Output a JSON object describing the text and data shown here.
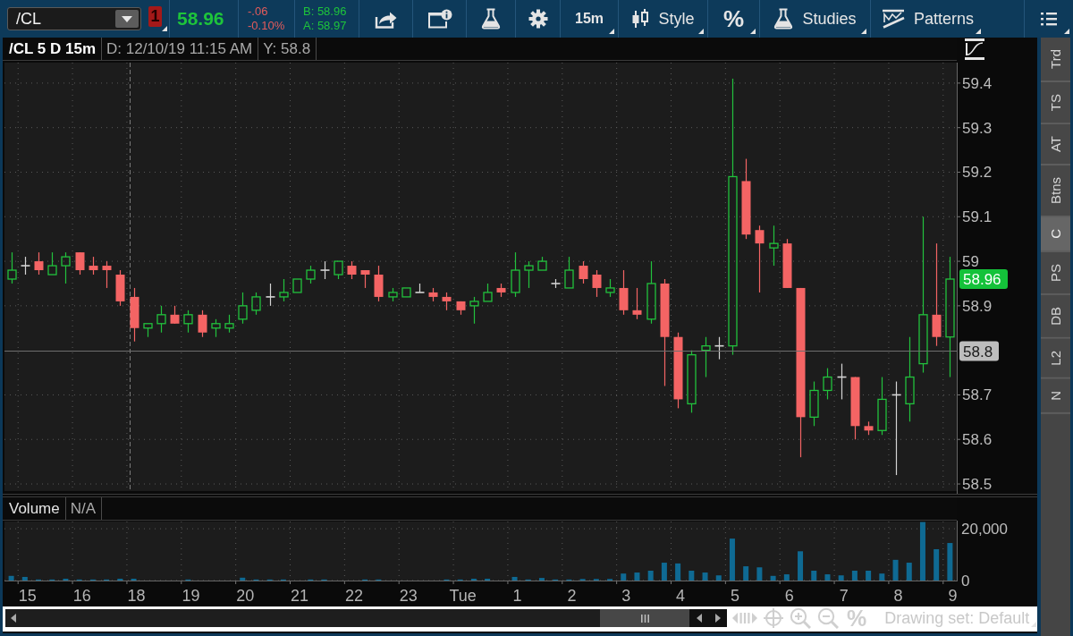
{
  "toolbar": {
    "symbol": "/CL",
    "alert_count": "1",
    "last_price": "58.96",
    "net_change": "-.06",
    "percent_change": "-0.10%",
    "bid": "B: 58.96",
    "ask": "A: 58.97",
    "buttons": [
      {
        "kind": "share",
        "dropdown": false
      },
      {
        "kind": "info",
        "dropdown": false
      },
      {
        "kind": "flask",
        "dropdown": false
      },
      {
        "kind": "gear",
        "dropdown": false
      },
      {
        "kind": "interval",
        "label": "15m",
        "dropdown": true
      },
      {
        "kind": "style",
        "label": "Style",
        "dropdown": true
      },
      {
        "kind": "percent",
        "label": "%",
        "dropdown": true
      },
      {
        "kind": "studies",
        "label": "Studies",
        "dropdown": true
      },
      {
        "kind": "patterns",
        "label": "Patterns",
        "dropdown": true
      },
      {
        "kind": "menu",
        "dropdown": true
      }
    ]
  },
  "chart": {
    "header": {
      "title": "/CL 5 D 15m",
      "date": "D: 12/10/19 11:15 AM",
      "cursor_value": "Y: 58.8"
    },
    "chart_data": {
      "type": "candlestick",
      "categories": [
        null,
        null,
        null,
        null,
        null,
        null,
        null,
        null,
        null,
        null,
        null,
        null,
        null,
        null,
        null,
        null,
        null,
        null,
        null,
        null,
        null,
        null,
        null,
        null,
        null,
        null,
        null,
        null,
        null,
        null,
        null,
        null,
        null,
        null,
        null,
        null,
        null,
        null,
        null,
        null,
        null,
        null,
        null,
        null,
        null,
        null,
        null,
        null,
        null,
        null,
        null,
        null,
        null,
        null,
        null,
        null,
        null,
        null,
        null,
        null,
        null,
        null,
        null,
        null,
        null,
        null,
        null,
        null,
        null,
        null
      ],
      "ohlc": [
        [
          58.96,
          59.02,
          58.95,
          58.98
        ],
        [
          58.99,
          59.01,
          58.97,
          58.99
        ],
        [
          59.0,
          59.02,
          58.97,
          58.98
        ],
        [
          58.97,
          59.02,
          58.97,
          58.99
        ],
        [
          58.99,
          59.02,
          58.95,
          59.01
        ],
        [
          59.02,
          59.02,
          58.97,
          58.98
        ],
        [
          58.99,
          59.01,
          58.97,
          58.98
        ],
        [
          58.99,
          59.0,
          58.94,
          58.98
        ],
        [
          58.97,
          58.98,
          58.9,
          58.91
        ],
        [
          58.92,
          58.94,
          58.82,
          58.85
        ],
        [
          58.85,
          58.86,
          58.83,
          58.86
        ],
        [
          58.86,
          58.9,
          58.84,
          58.88
        ],
        [
          58.88,
          58.9,
          58.86,
          58.86
        ],
        [
          58.86,
          58.89,
          58.84,
          58.88
        ],
        [
          58.88,
          58.89,
          58.83,
          58.84
        ],
        [
          58.85,
          58.87,
          58.83,
          58.86
        ],
        [
          58.85,
          58.88,
          58.84,
          58.86
        ],
        [
          58.87,
          58.93,
          58.86,
          58.9
        ],
        [
          58.89,
          58.93,
          58.88,
          58.92
        ],
        [
          58.92,
          58.95,
          58.9,
          58.92
        ],
        [
          58.92,
          58.96,
          58.91,
          58.93
        ],
        [
          58.93,
          58.96,
          58.93,
          58.96
        ],
        [
          58.96,
          58.99,
          58.95,
          58.98
        ],
        [
          58.98,
          59.0,
          58.96,
          58.98
        ],
        [
          58.97,
          59.0,
          58.96,
          59.0
        ],
        [
          58.99,
          59.0,
          58.96,
          58.97
        ],
        [
          58.98,
          58.98,
          58.94,
          58.97
        ],
        [
          58.97,
          58.99,
          58.91,
          58.92
        ],
        [
          58.92,
          58.94,
          58.91,
          58.93
        ],
        [
          58.92,
          58.94,
          58.92,
          58.94
        ],
        [
          58.93,
          58.95,
          58.93,
          58.93
        ],
        [
          58.93,
          58.94,
          58.91,
          58.92
        ],
        [
          58.92,
          58.93,
          58.89,
          58.91
        ],
        [
          58.91,
          58.91,
          58.88,
          58.89
        ],
        [
          58.9,
          58.92,
          58.86,
          58.91
        ],
        [
          58.91,
          58.95,
          58.91,
          58.93
        ],
        [
          58.94,
          58.95,
          58.92,
          58.93
        ],
        [
          58.93,
          59.02,
          58.92,
          58.98
        ],
        [
          58.98,
          59.0,
          58.94,
          58.99
        ],
        [
          58.98,
          59.01,
          58.98,
          59.0
        ],
        [
          58.95,
          58.96,
          58.94,
          58.95
        ],
        [
          58.94,
          59.01,
          58.94,
          58.98
        ],
        [
          58.99,
          59.0,
          58.95,
          58.96
        ],
        [
          58.97,
          58.98,
          58.92,
          58.94
        ],
        [
          58.93,
          58.96,
          58.92,
          58.94
        ],
        [
          58.94,
          58.98,
          58.88,
          58.89
        ],
        [
          58.89,
          58.94,
          58.87,
          58.88
        ],
        [
          58.87,
          59.0,
          58.86,
          58.95
        ],
        [
          58.95,
          58.96,
          58.72,
          58.83
        ],
        [
          58.83,
          58.84,
          58.67,
          58.69
        ],
        [
          58.68,
          58.8,
          58.66,
          58.79
        ],
        [
          58.8,
          58.83,
          58.74,
          58.81
        ],
        [
          58.81,
          58.83,
          58.78,
          58.81
        ],
        [
          58.81,
          59.41,
          58.79,
          59.19
        ],
        [
          59.18,
          59.23,
          59.05,
          59.06
        ],
        [
          59.07,
          59.08,
          58.93,
          59.04
        ],
        [
          59.03,
          59.08,
          58.99,
          59.04
        ],
        [
          59.04,
          59.05,
          58.94,
          58.94
        ],
        [
          58.94,
          58.94,
          58.56,
          58.65
        ],
        [
          58.65,
          58.73,
          58.63,
          58.71
        ],
        [
          58.71,
          58.76,
          58.69,
          58.74
        ],
        [
          58.74,
          58.77,
          58.69,
          58.74
        ],
        [
          58.74,
          58.74,
          58.6,
          58.63
        ],
        [
          58.63,
          58.64,
          58.61,
          58.62
        ],
        [
          58.62,
          58.74,
          58.61,
          58.69
        ],
        [
          58.7,
          58.73,
          58.52,
          58.7
        ],
        [
          58.68,
          58.83,
          58.64,
          58.74
        ],
        [
          58.77,
          59.1,
          58.75,
          58.88
        ],
        [
          58.88,
          59.04,
          58.81,
          58.83
        ],
        [
          58.83,
          59.01,
          58.74,
          58.96
        ]
      ],
      "ylim": [
        58.484,
        59.446
      ],
      "yticks": [
        59.4,
        59.3,
        59.2,
        59.1,
        59,
        58.9,
        58.7,
        58.6,
        58.5
      ],
      "grid": true,
      "ref_lines": [
        {
          "axis": "y",
          "value": 58.8,
          "label": "58.8"
        }
      ]
    },
    "last_price_badge": "58.96"
  },
  "volume": {
    "value": "N/A",
    "chart_data": {
      "type": "bar",
      "title": "Volume",
      "categories": [
        null,
        "15",
        null,
        null,
        null,
        "16",
        null,
        null,
        null,
        "18",
        null,
        null,
        null,
        "19",
        null,
        null,
        null,
        "20",
        null,
        null,
        null,
        "21",
        null,
        null,
        null,
        "22",
        null,
        null,
        null,
        "23",
        null,
        null,
        null,
        "Tue",
        null,
        null,
        null,
        "1",
        null,
        null,
        null,
        "2",
        null,
        null,
        null,
        "3",
        null,
        null,
        null,
        "4",
        null,
        null,
        null,
        "5",
        null,
        null,
        null,
        "6",
        null,
        null,
        null,
        "7",
        null,
        null,
        null,
        "8",
        null,
        null,
        null,
        "9"
      ],
      "values": [
        1800,
        1400,
        400,
        400,
        700,
        400,
        400,
        400,
        700,
        700,
        null,
        null,
        null,
        400,
        null,
        null,
        null,
        1100,
        400,
        400,
        400,
        null,
        400,
        400,
        null,
        null,
        400,
        400,
        null,
        null,
        null,
        null,
        400,
        400,
        700,
        700,
        null,
        1400,
        400,
        1000,
        400,
        400,
        600,
        600,
        600,
        2700,
        3100,
        3800,
        6900,
        6600,
        3800,
        3100,
        2000,
        16200,
        5500,
        5100,
        1800,
        2400,
        11300,
        3800,
        2400,
        2000,
        3800,
        3800,
        2700,
        8000,
        6900,
        22600,
        12100,
        14500
      ],
      "ylim": [
        0,
        22800
      ],
      "yticks": [
        {
          "value": 0,
          "label": "0"
        },
        {
          "value": 20000,
          "label": "20,000"
        }
      ],
      "grid": true
    }
  },
  "bottom_tools": {
    "buttons": [
      {
        "kind": "pan"
      },
      {
        "kind": "crosshair"
      },
      {
        "kind": "zoom_in"
      },
      {
        "kind": "zoom_out"
      },
      {
        "kind": "percent",
        "label": "%"
      }
    ],
    "drawing_set": "Drawing set: Default"
  },
  "side_tabs": [
    {
      "label": "Trd",
      "selected": false
    },
    {
      "label": "TS",
      "selected": false
    },
    {
      "label": "AT",
      "selected": false
    },
    {
      "label": "Btns",
      "selected": false
    },
    {
      "label": "C",
      "selected": true
    },
    {
      "label": "PS",
      "selected": false
    },
    {
      "label": "DB",
      "selected": false
    },
    {
      "label": "L2",
      "selected": false
    },
    {
      "label": "N",
      "selected": false
    }
  ]
}
